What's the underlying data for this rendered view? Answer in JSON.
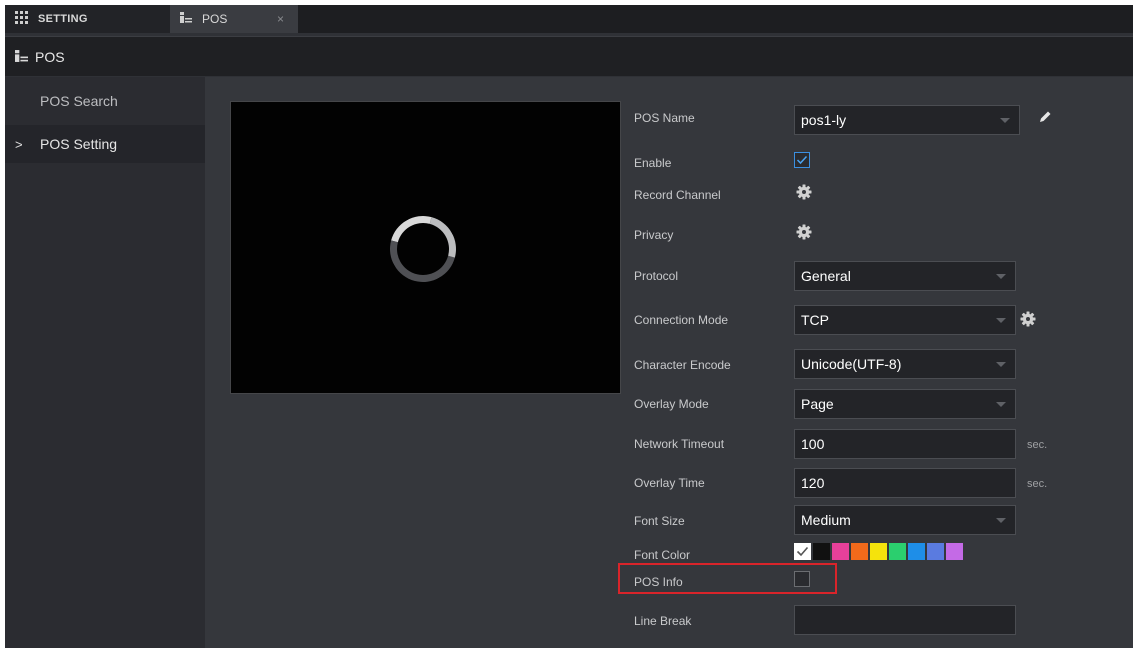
{
  "tabs": {
    "setting_label": "SETTING",
    "pos_label": "POS",
    "close_glyph": "×"
  },
  "header": {
    "title": "POS"
  },
  "sidebar": {
    "items": [
      {
        "label": "POS Search"
      },
      {
        "label": "POS Setting",
        "chevron": ">"
      }
    ]
  },
  "form": {
    "pos_name": {
      "label": "POS Name",
      "value": "pos1-ly"
    },
    "enable": {
      "label": "Enable",
      "checked": true
    },
    "record_channel": {
      "label": "Record Channel"
    },
    "privacy": {
      "label": "Privacy"
    },
    "protocol": {
      "label": "Protocol",
      "value": "General"
    },
    "connection_mode": {
      "label": "Connection Mode",
      "value": "TCP"
    },
    "character_encode": {
      "label": "Character Encode",
      "value": "Unicode(UTF-8)"
    },
    "overlay_mode": {
      "label": "Overlay Mode",
      "value": "Page"
    },
    "network_timeout": {
      "label": "Network Timeout",
      "value": "100",
      "unit": "sec."
    },
    "overlay_time": {
      "label": "Overlay Time",
      "value": "120",
      "unit": "sec."
    },
    "font_size": {
      "label": "Font Size",
      "value": "Medium"
    },
    "font_color": {
      "label": "Font Color",
      "colors": [
        "#ffffff",
        "#111111",
        "#e8409a",
        "#f26a1b",
        "#f5e30c",
        "#2bcf6e",
        "#1e8ee8",
        "#5a7be0",
        "#c46ae6"
      ]
    },
    "pos_info": {
      "label": "POS Info",
      "checked": false
    },
    "line_break": {
      "label": "Line Break",
      "value": ""
    }
  },
  "colors": {
    "highlight": "#d9242a",
    "accent": "#3b8fe0"
  }
}
